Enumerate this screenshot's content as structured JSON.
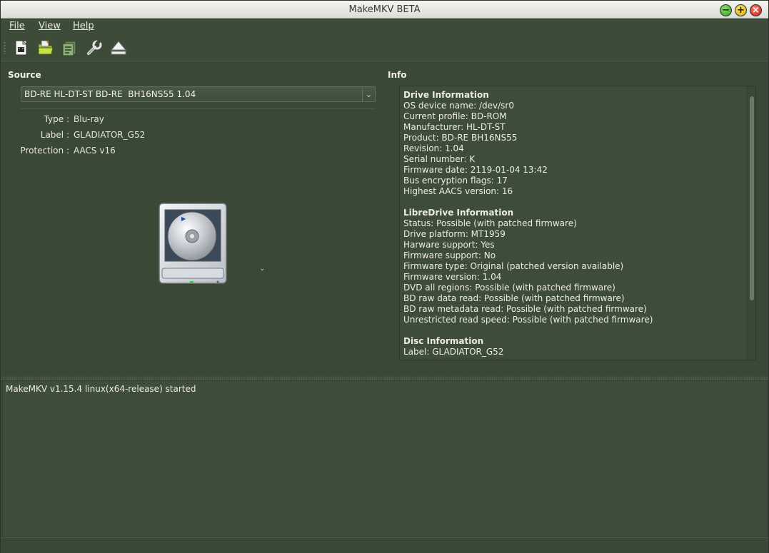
{
  "window": {
    "title": "MakeMKV BETA"
  },
  "menu": {
    "items": [
      "File",
      "View",
      "Help"
    ]
  },
  "toolbar": {
    "buttons": [
      {
        "icon": "open-files-icon"
      },
      {
        "icon": "open-folder-icon"
      },
      {
        "icon": "backup-icon"
      },
      {
        "icon": "preferences-wrench-icon"
      },
      {
        "icon": "eject-icon"
      }
    ]
  },
  "source": {
    "label": "Source",
    "drive_selected": "BD-RE HL-DT-ST BD-RE  BH16NS55 1.04",
    "properties": [
      {
        "key": "Type :",
        "value": "Blu-ray"
      },
      {
        "key": "Label :",
        "value": "GLADIATOR_G52"
      },
      {
        "key": "Protection :",
        "value": "AACS v16"
      }
    ],
    "chevron": "⌄"
  },
  "info": {
    "label": "Info",
    "lines": [
      {
        "text": "Drive Information",
        "bold": true
      },
      {
        "text": "OS device name: /dev/sr0"
      },
      {
        "text": "Current profile: BD-ROM"
      },
      {
        "text": "Manufacturer: HL-DT-ST"
      },
      {
        "text": "Product: BD-RE BH16NS55"
      },
      {
        "text": "Revision: 1.04"
      },
      {
        "text": "Serial number: K"
      },
      {
        "text": "Firmware date: 2119-01-04 13:42"
      },
      {
        "text": "Bus encryption flags: 17"
      },
      {
        "text": "Highest AACS version: 16"
      },
      {
        "text": "",
        "gap": true
      },
      {
        "text": "LibreDrive Information",
        "bold": true
      },
      {
        "text": "Status: Possible (with patched firmware)"
      },
      {
        "text": "Drive platform: MT1959"
      },
      {
        "text": "Harware support: Yes"
      },
      {
        "text": "Firmware support: No"
      },
      {
        "text": "Firmware type: Original (patched version available)"
      },
      {
        "text": "Firmware version: 1.04"
      },
      {
        "text": "DVD all regions: Possible (with patched firmware)"
      },
      {
        "text": "BD raw data read: Possible (with patched firmware)"
      },
      {
        "text": "BD raw metadata read: Possible (with patched firmware)"
      },
      {
        "text": "Unrestricted read speed: Possible (with patched firmware)"
      },
      {
        "text": "",
        "gap": true
      },
      {
        "text": "Disc Information",
        "bold": true
      },
      {
        "text": "Label: GLADIATOR_G52"
      }
    ]
  },
  "log": {
    "lines": [
      "MakeMKV v1.15.4 linux(x64-release) started"
    ]
  },
  "colors": {
    "background": "#3a4836",
    "text": "#e9e9e2"
  }
}
